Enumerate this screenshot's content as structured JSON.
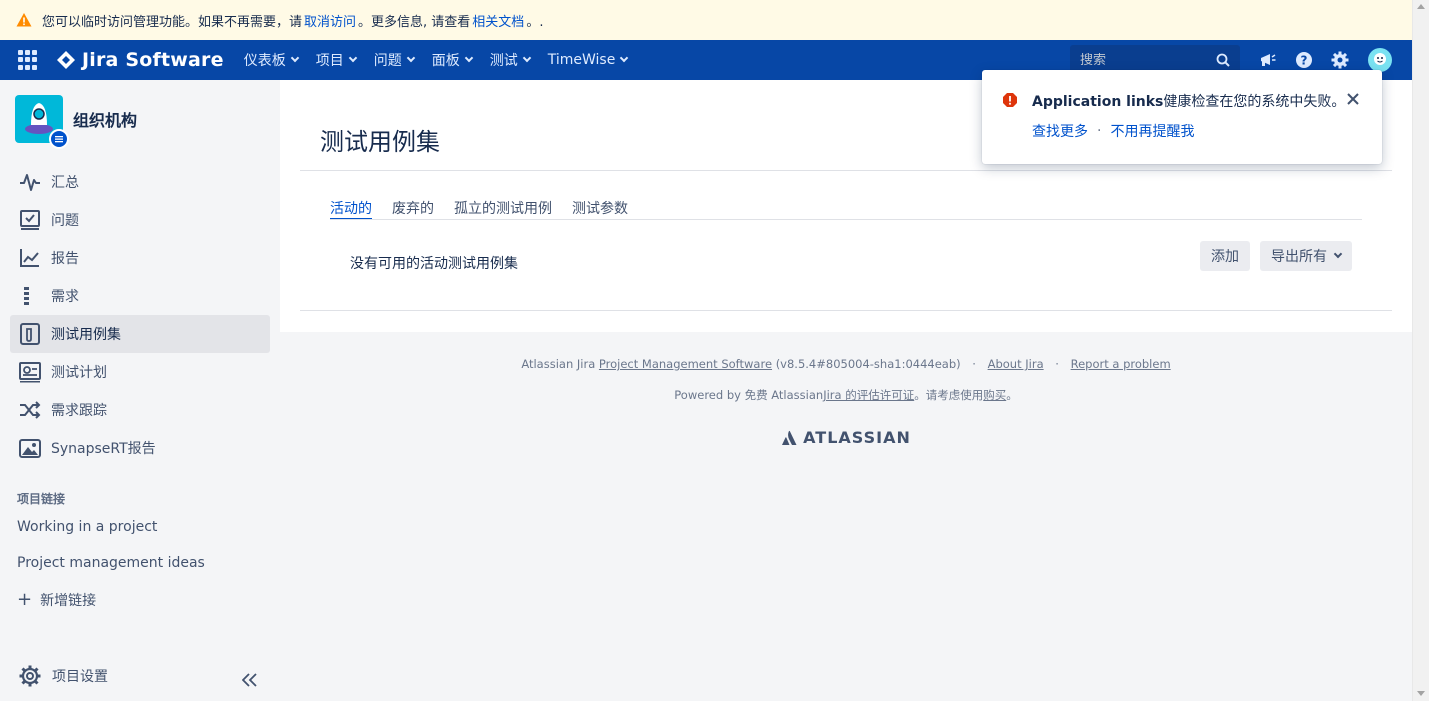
{
  "banner": {
    "text_before": "您可以临时访问管理功能。如果不再需要，请",
    "revoke_link": "取消访问",
    "text_middle": "。更多信息, 请查看",
    "docs_link": "相关文档",
    "text_after": "。."
  },
  "topnav": {
    "product": "Jira Software",
    "items": [
      "仪表板",
      "项目",
      "问题",
      "面板",
      "测试",
      "TimeWise"
    ],
    "search_placeholder": "搜索"
  },
  "sidebar": {
    "project_name": "组织机构",
    "items": [
      {
        "label": "汇总",
        "icon": "activity-icon"
      },
      {
        "label": "问题",
        "icon": "issues-icon"
      },
      {
        "label": "报告",
        "icon": "reports-icon"
      },
      {
        "label": "需求",
        "icon": "requirements-icon"
      },
      {
        "label": "测试用例集",
        "icon": "test-suite-icon",
        "active": true
      },
      {
        "label": "测试计划",
        "icon": "test-plan-icon"
      },
      {
        "label": "需求跟踪",
        "icon": "traceability-icon"
      },
      {
        "label": "SynapseRT报告",
        "icon": "image-report-icon"
      }
    ],
    "section_title": "项目链接",
    "links": [
      "Working in a project",
      "Project management ideas"
    ],
    "add_link": "新增链接",
    "settings": "项目设置"
  },
  "main": {
    "title": "测试用例集",
    "tabs": [
      "活动的",
      "废弃的",
      "孤立的测试用例",
      "测试参数"
    ],
    "active_tab": 0,
    "empty_message": "没有可用的活动测试用例集",
    "add_button": "添加",
    "export_button": "导出所有"
  },
  "footer": {
    "line1_prefix": "Atlassian Jira",
    "pms_link": "Project Management Software",
    "version": "(v8.5.4#805004-sha1:0444eab)",
    "sep": "·",
    "about": "About Jira",
    "report": "Report a problem",
    "line2_prefix": "Powered by 免费 Atlassian",
    "license_link": "Jira 的评估许可证",
    "line2_middle": "。请考虑使用",
    "buy_link": "购买",
    "line2_suffix": "。",
    "atlassian_logo": "ATLASSIAN"
  },
  "flag": {
    "title_bold": "Application links",
    "title_rest": "健康检查在您的系统中失败。",
    "action1": "查找更多",
    "dot": "·",
    "action2": "不用再提醒我"
  },
  "colors": {
    "nav_bg": "#0747a6",
    "banner_bg": "#fffae6",
    "link": "#0052cc",
    "error": "#de350b",
    "warning": "#ff8b00"
  }
}
